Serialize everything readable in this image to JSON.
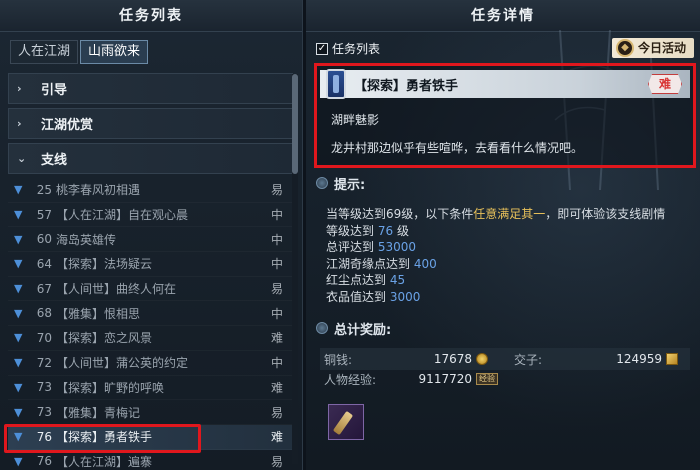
{
  "left": {
    "title": "任务列表",
    "tabs": [
      "人在江湖",
      "山雨欲来"
    ],
    "categories": [
      {
        "label": "引导",
        "chevron": "›"
      },
      {
        "label": "江湖优赏",
        "chevron": "›"
      },
      {
        "label": "支线",
        "chevron": "⌄"
      }
    ],
    "quests": [
      {
        "num": "25",
        "name": "桃李春风初相遇",
        "diff": "易"
      },
      {
        "num": "57",
        "name": "【人在江湖】自在观心晨",
        "diff": "中"
      },
      {
        "num": "60",
        "name": "海岛英雄传",
        "diff": "中"
      },
      {
        "num": "64",
        "name": "【探索】法场疑云",
        "diff": "中"
      },
      {
        "num": "67",
        "name": "【人间世】曲终人何在",
        "diff": "易"
      },
      {
        "num": "68",
        "name": "【雅集】恨相思",
        "diff": "中"
      },
      {
        "num": "70",
        "name": "【探索】恋之风景",
        "diff": "难"
      },
      {
        "num": "72",
        "name": "【人间世】蒲公英的约定",
        "diff": "中"
      },
      {
        "num": "73",
        "name": "【探索】旷野的呼唤",
        "diff": "难"
      },
      {
        "num": "73",
        "name": "【雅集】青梅记",
        "diff": "易"
      },
      {
        "num": "76",
        "name": "【探索】勇者铁手",
        "diff": "难"
      },
      {
        "num": "76",
        "name": "【人在江湖】遍寨",
        "diff": "易"
      }
    ]
  },
  "right": {
    "title": "任务详情",
    "checkbox_label": "任务列表",
    "daily_label": "今日活动",
    "quest_title": "【探索】勇者铁手",
    "difficulty": "难",
    "subtitle": "湖畔魅影",
    "description": "龙井村那边似乎有些喧哗，去看看什么情况吧。",
    "tips_label": "提示:",
    "req_intro_a": "当等级达到69级，以下条件",
    "req_intro_hl": "任意满足其一",
    "req_intro_b": "，即可体验该支线剧情",
    "reqs": [
      {
        "label": "等级达到",
        "value": "76",
        "suffix": "级"
      },
      {
        "label": "总评达到",
        "value": "53000",
        "suffix": ""
      },
      {
        "label": "江湖奇缘点达到",
        "value": "400",
        "suffix": ""
      },
      {
        "label": "红尘点达到",
        "value": "45",
        "suffix": ""
      },
      {
        "label": "衣品值达到",
        "value": "3000",
        "suffix": ""
      }
    ],
    "reward_label": "总计奖励:",
    "rewards": {
      "copper_label": "铜钱:",
      "copper_value": "17678",
      "note_label": "交子:",
      "note_value": "124959",
      "exp_label": "人物经验:",
      "exp_value": "9117720",
      "exp_badge": "经验"
    },
    "accent_red": "#e0171d",
    "accent_blue": "#4d8fd8",
    "accent_gold": "#e8c15a"
  }
}
